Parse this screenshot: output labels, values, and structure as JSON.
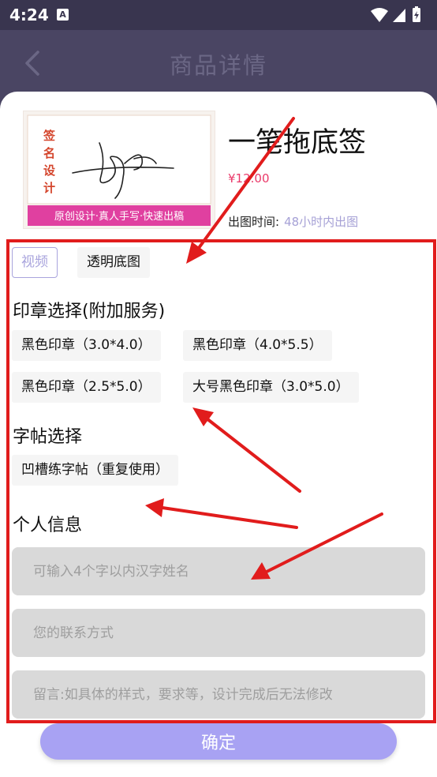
{
  "status_bar": {
    "time": "4:24",
    "notif_icon_letter": "A"
  },
  "header": {
    "title": "商品详情"
  },
  "product": {
    "image": {
      "vertical_text": [
        "签",
        "名",
        "设",
        "计"
      ],
      "banner": "原创设计·真人手写·快速出稿"
    },
    "name": "一笔拖底签",
    "price": "¥12.00",
    "time_label": "出图时间:",
    "time_value": "48小时内出图"
  },
  "media_tabs": {
    "video": "视频",
    "transparent": "透明底图"
  },
  "seal_section": {
    "title": "印章选择(附加服务)",
    "options": [
      "黑色印章（3.0*4.0）",
      "黑色印章（4.0*5.5）",
      "黑色印章（2.5*5.0）",
      "大号黑色印章（3.0*5.0）"
    ]
  },
  "copybook_section": {
    "title": "字帖选择",
    "options": [
      "凹槽练字帖（重复使用）"
    ]
  },
  "info_section": {
    "title": "个人信息",
    "name_placeholder": "可输入4个字以内汉字姓名",
    "contact_placeholder": "您的联系方式",
    "message_placeholder": "留言:如具体的样式，要求等，设计完成后无法修改"
  },
  "confirm_label": "确定",
  "colors": {
    "header_bg": "#4a4563",
    "accent": "#a8a2f3",
    "price": "#ea3a6a",
    "annotation_red": "#e11c1c"
  }
}
